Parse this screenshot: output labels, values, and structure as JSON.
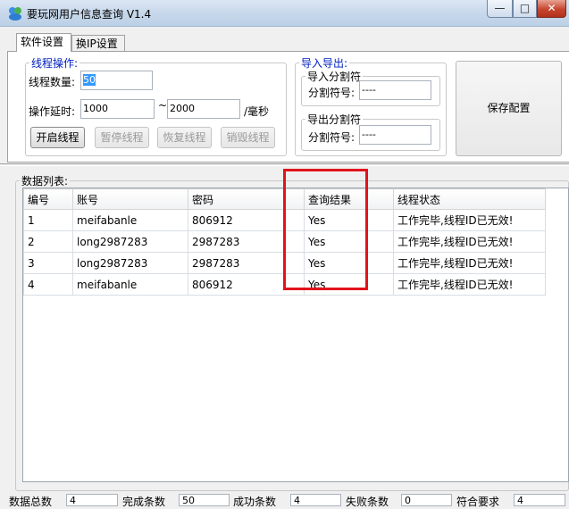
{
  "window": {
    "title": "要玩网用户信息查询 V1.4",
    "min_glyph": "—",
    "max_glyph": "□",
    "close_glyph": "✕"
  },
  "tabs": [
    {
      "label": "软件设置",
      "active": true
    },
    {
      "label": "换IP设置",
      "active": false
    }
  ],
  "thread_ops": {
    "legend": "线程操作:",
    "count_label": "线程数量:",
    "count_value": "50",
    "delay_label": "操作延时:",
    "delay_from": "1000",
    "tilde": "~",
    "delay_to": "2000",
    "unit": "/毫秒",
    "buttons": {
      "start": "开启线程",
      "pause": "暂停线程",
      "resume": "恢复线程",
      "destroy": "销毁线程"
    }
  },
  "import_export": {
    "legend": "导入导出:",
    "import_legend": "导入分割符",
    "import_label": "分割符号:",
    "import_value": "----",
    "export_legend": "导出分割符",
    "export_label": "分割符号:",
    "export_value": "----"
  },
  "save_button": "保存配置",
  "data_list": {
    "legend": "数据列表:",
    "columns": [
      "编号",
      "账号",
      "密码",
      "查询结果",
      "线程状态"
    ],
    "rows": [
      [
        "1",
        "meifabanle",
        "806912",
        "Yes",
        "工作完毕,线程ID已无效!"
      ],
      [
        "2",
        "long2987283",
        "2987283",
        "Yes",
        "工作完毕,线程ID已无效!"
      ],
      [
        "3",
        "long2987283",
        "2987283",
        "Yes",
        "工作完毕,线程ID已无效!"
      ],
      [
        "4",
        "meifabanle",
        "806912",
        "Yes",
        "工作完毕,线程ID已无效!"
      ]
    ]
  },
  "status_bar": {
    "total_label": "数据总数",
    "total_value": "4",
    "done_label": "完成条数",
    "done_value": "50",
    "success_label": "成功条数",
    "success_value": "4",
    "fail_label": "失败条数",
    "fail_value": "0",
    "match_label": "符合要求",
    "match_value": "4"
  },
  "colors": {
    "highlight": "#e1141c",
    "legend_blue": "#0020c0",
    "selection": "#3399ff"
  }
}
